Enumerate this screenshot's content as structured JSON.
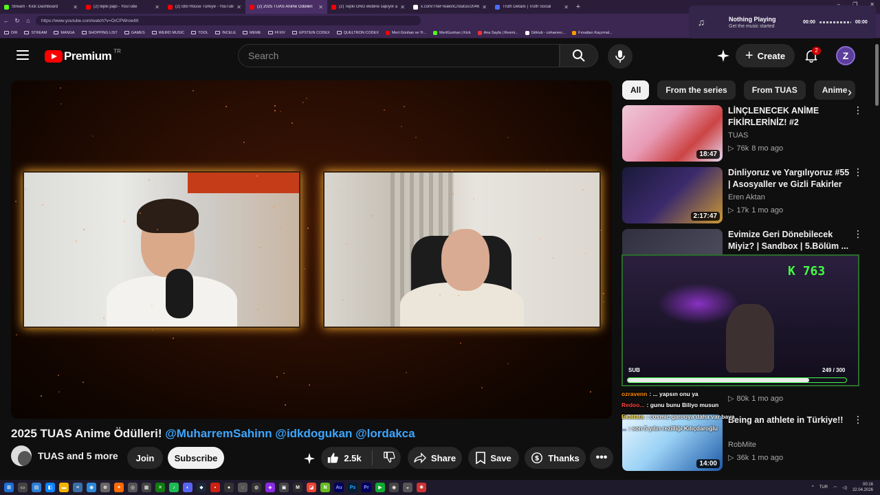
{
  "browser": {
    "tabs": [
      {
        "title": "Stream - Kick Dashboard",
        "color": "#53fc18",
        "active": false
      },
      {
        "title": "(2) tepki papi - YouTube",
        "color": "#ff0000",
        "active": false
      },
      {
        "title": "(2) Idol House Türkiye - YouTube",
        "color": "#ff0000",
        "active": false
      },
      {
        "title": "(2) 2025 TUAS Anime Ödülleri",
        "color": "#ff0000",
        "active": true
      },
      {
        "title": "(2) Tepki GNG ekibine sapıyor am",
        "color": "#ff0000",
        "active": false
      },
      {
        "title": "x.com/TheFreakinC/status/20463",
        "color": "#ffffff",
        "active": false
      },
      {
        "title": "Truth Details | Truth Social",
        "color": "#4a6cf7",
        "active": false
      }
    ],
    "url": "https://www.youtube.com/watch?v=OrCPWrowtIII",
    "bookmarks": [
      {
        "label": "DIR",
        "type": "folder"
      },
      {
        "label": "STREAM",
        "type": "folder"
      },
      {
        "label": "MANGA",
        "type": "folder"
      },
      {
        "label": "SHOPPING LIST",
        "type": "folder"
      },
      {
        "label": "GAMES",
        "type": "folder"
      },
      {
        "label": "WEIRD MUSIC",
        "type": "folder"
      },
      {
        "label": "TOOL",
        "type": "folder"
      },
      {
        "label": "İNCELE",
        "type": "folder"
      },
      {
        "label": "MEME",
        "type": "folder"
      },
      {
        "label": "FFXIV",
        "type": "folder"
      },
      {
        "label": "EPSTEIN CODEX",
        "type": "folder"
      },
      {
        "label": "QUELTRON CODEX",
        "type": "folder"
      },
      {
        "label": "Mert Günhan ve Yi...",
        "type": "site",
        "color": "#ff0000"
      },
      {
        "label": "MertGunhan | Kick",
        "type": "site",
        "color": "#53fc18"
      },
      {
        "label": "Ana Sayfa | Resmi...",
        "type": "site",
        "color": "#e33"
      },
      {
        "label": "GitHub - cohaereo...",
        "type": "site",
        "color": "#ffffff"
      },
      {
        "label": "Fırsatları Kaçırmal...",
        "type": "site",
        "color": "#f90"
      }
    ]
  },
  "music": {
    "title": "Nothing Playing",
    "subtitle": "Get the music started",
    "time_start": "00:00",
    "time_end": "00:00"
  },
  "header": {
    "brand": "Premium",
    "country": "TR",
    "search_placeholder": "Search",
    "create_label": "Create",
    "notif_count": "2"
  },
  "video": {
    "title_main": "2025 TUAS Anime Ödülleri!",
    "title_tags": "@MuharremSahinn @idkdogukan @lordakca",
    "owner": "TUAS and 5 more",
    "join_label": "Join",
    "subscribe_label": "Subscribe",
    "likes": "2.5k",
    "share_label": "Share",
    "save_label": "Save",
    "thanks_label": "Thanks"
  },
  "chips": [
    "All",
    "From the series",
    "From TUAS",
    "Anime"
  ],
  "recommendations": [
    {
      "title": "LİNÇLENECEK ANİME FİKİRLERİNİZ! #2",
      "channel": "TUAS",
      "views": "76k",
      "age": "8 mo ago",
      "duration": "18:47"
    },
    {
      "title": "Dinliyoruz ve Yargılıyoruz #55 | Asosyaller ve Gizli Fakirler",
      "channel": "Eren Aktan",
      "views": "17k",
      "age": "1 mo ago",
      "duration": "2:17:47"
    },
    {
      "title": "Evimize Geri Dönebilecek Miyiz? | Sandbox | 5.Bölüm ...",
      "channel": "",
      "views": "",
      "age": "",
      "duration": ""
    },
    {
      "title": "",
      "channel": "",
      "views": "80k",
      "age": "1 mo ago",
      "duration": ""
    },
    {
      "title": "Being an athlete in Türkiye!!",
      "channel": "RobMite",
      "views": "36k",
      "age": "1 mo ago",
      "duration": "14:00"
    }
  ],
  "stream_overlay": {
    "count": "763",
    "sub_label": "SUB",
    "sub_progress": "249 / 300",
    "sub_fraction": 0.83
  },
  "chat": [
    {
      "user": "ozravenn",
      "user_color": "#ff8c00",
      "msg": ": ... yapsın onu ya"
    },
    {
      "user": "Redoo...",
      "user_color": "#ff4040",
      "msg": ": gunu bunu Biliyo musun"
    },
    {
      "user": "Exaltata",
      "user_color": "#ffe14d",
      "msg": ": cosmic garouya daha var baya"
    },
    {
      "user": "...",
      "user_color": "#8a7cff",
      "msg": ": son 5 yılın rezilliği Kılıçdaroğlu"
    }
  ],
  "taskbar": {
    "lang": "TUR",
    "time": "00:16",
    "date": "22.04.2026"
  }
}
